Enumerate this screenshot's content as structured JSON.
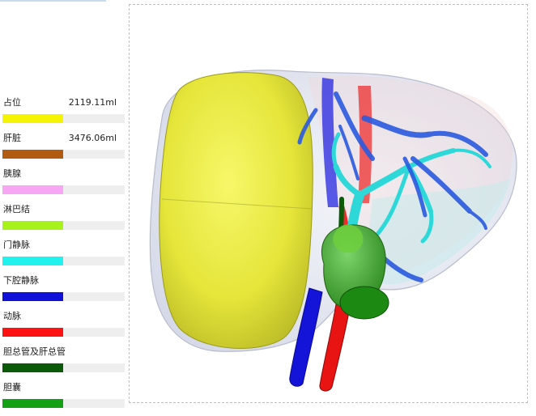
{
  "legend": {
    "items": [
      {
        "label": "占位",
        "value": "2119.11ml",
        "color": "#f4f400"
      },
      {
        "label": "肝脏",
        "value": "3476.06ml",
        "color": "#b05a12"
      },
      {
        "label": "胰腺",
        "value": "",
        "color": "#f6a6f2"
      },
      {
        "label": "淋巴结",
        "value": "",
        "color": "#a6f21a"
      },
      {
        "label": "门静脉",
        "value": "",
        "color": "#22f2ee"
      },
      {
        "label": "下腔静脉",
        "value": "",
        "color": "#1010d8"
      },
      {
        "label": "动脉",
        "value": "",
        "color": "#ff1212"
      },
      {
        "label": "胆总管及肝总管",
        "value": "",
        "color": "#0a5a0a"
      },
      {
        "label": "胆囊",
        "value": "",
        "color": "#14a014"
      }
    ]
  }
}
